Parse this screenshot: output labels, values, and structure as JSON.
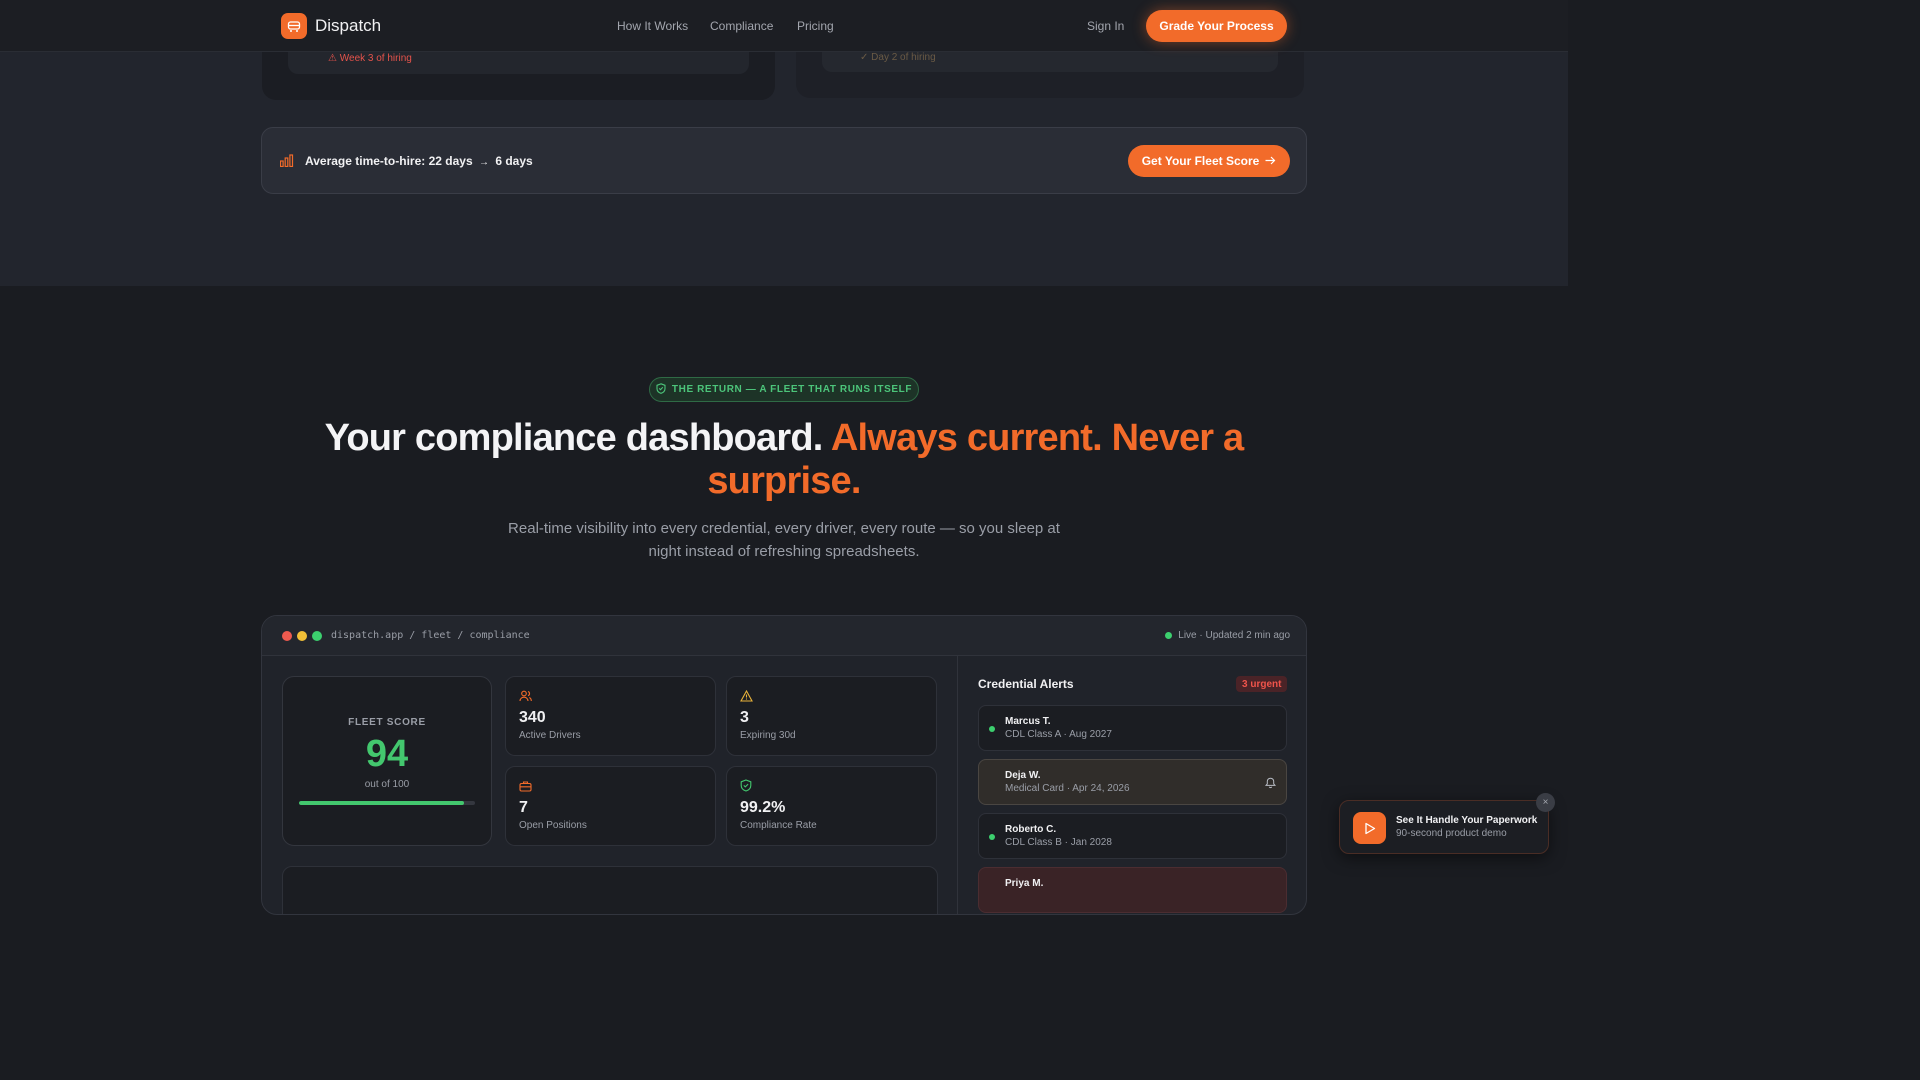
{
  "nav": {
    "brand": "Dispatch",
    "links": [
      "How It Works",
      "Compliance",
      "Pricing"
    ],
    "sign_in": "Sign In",
    "cta": "Grade Your Process"
  },
  "compare": {
    "left_note": "⚠ Week 3 of hiring",
    "right_note": "✓ Day 2 of hiring"
  },
  "banner": {
    "text_prefix": "Average time-to-hire: 22 days",
    "arrow": "→",
    "text_suffix": "6 days",
    "cta": "Get Your Fleet Score"
  },
  "section": {
    "pill": "THE RETURN — A FLEET THAT RUNS ITSELF",
    "headline_main": "Your compliance dashboard.",
    "headline_accent": "Always current. Never a surprise.",
    "subtext": "Real-time visibility into every credential, every driver, every route — so you sleep at night instead of refreshing spreadsheets."
  },
  "dashboard": {
    "url": "dispatch.app / fleet / compliance",
    "live": "Live · Updated 2 min ago",
    "score": {
      "label": "FLEET SCORE",
      "value": "94",
      "sub": "out of 100",
      "progress": 0.94
    },
    "stats": [
      {
        "icon": "users-icon",
        "value": "340",
        "label": "Active Drivers"
      },
      {
        "icon": "warning-icon",
        "value": "3",
        "label": "Expiring 30d"
      },
      {
        "icon": "briefcase-icon",
        "value": "7",
        "label": "Open Positions"
      },
      {
        "icon": "shield-check-icon",
        "value": "99.2%",
        "label": "Compliance Rate"
      }
    ],
    "alerts_title": "Credential Alerts",
    "alerts_badge": "3 urgent",
    "alerts": [
      {
        "name": "Marcus T.",
        "meta": "CDL Class A · Aug 2027",
        "status": "ok"
      },
      {
        "name": "Deja W.",
        "meta": "Medical Card · Apr 24, 2026",
        "status": "warn"
      },
      {
        "name": "Roberto C.",
        "meta": "CDL Class B · Jan 2028",
        "status": "ok"
      },
      {
        "name": "Priya M.",
        "meta": "",
        "status": "urgent"
      }
    ]
  },
  "toast": {
    "title": "See It Handle Your Paperwork",
    "sub": "90-second product demo",
    "close": "×"
  },
  "colors": {
    "accent": "#f26b2a",
    "success": "#43c76e",
    "danger": "#f0544b",
    "warning": "#e8b23a"
  }
}
